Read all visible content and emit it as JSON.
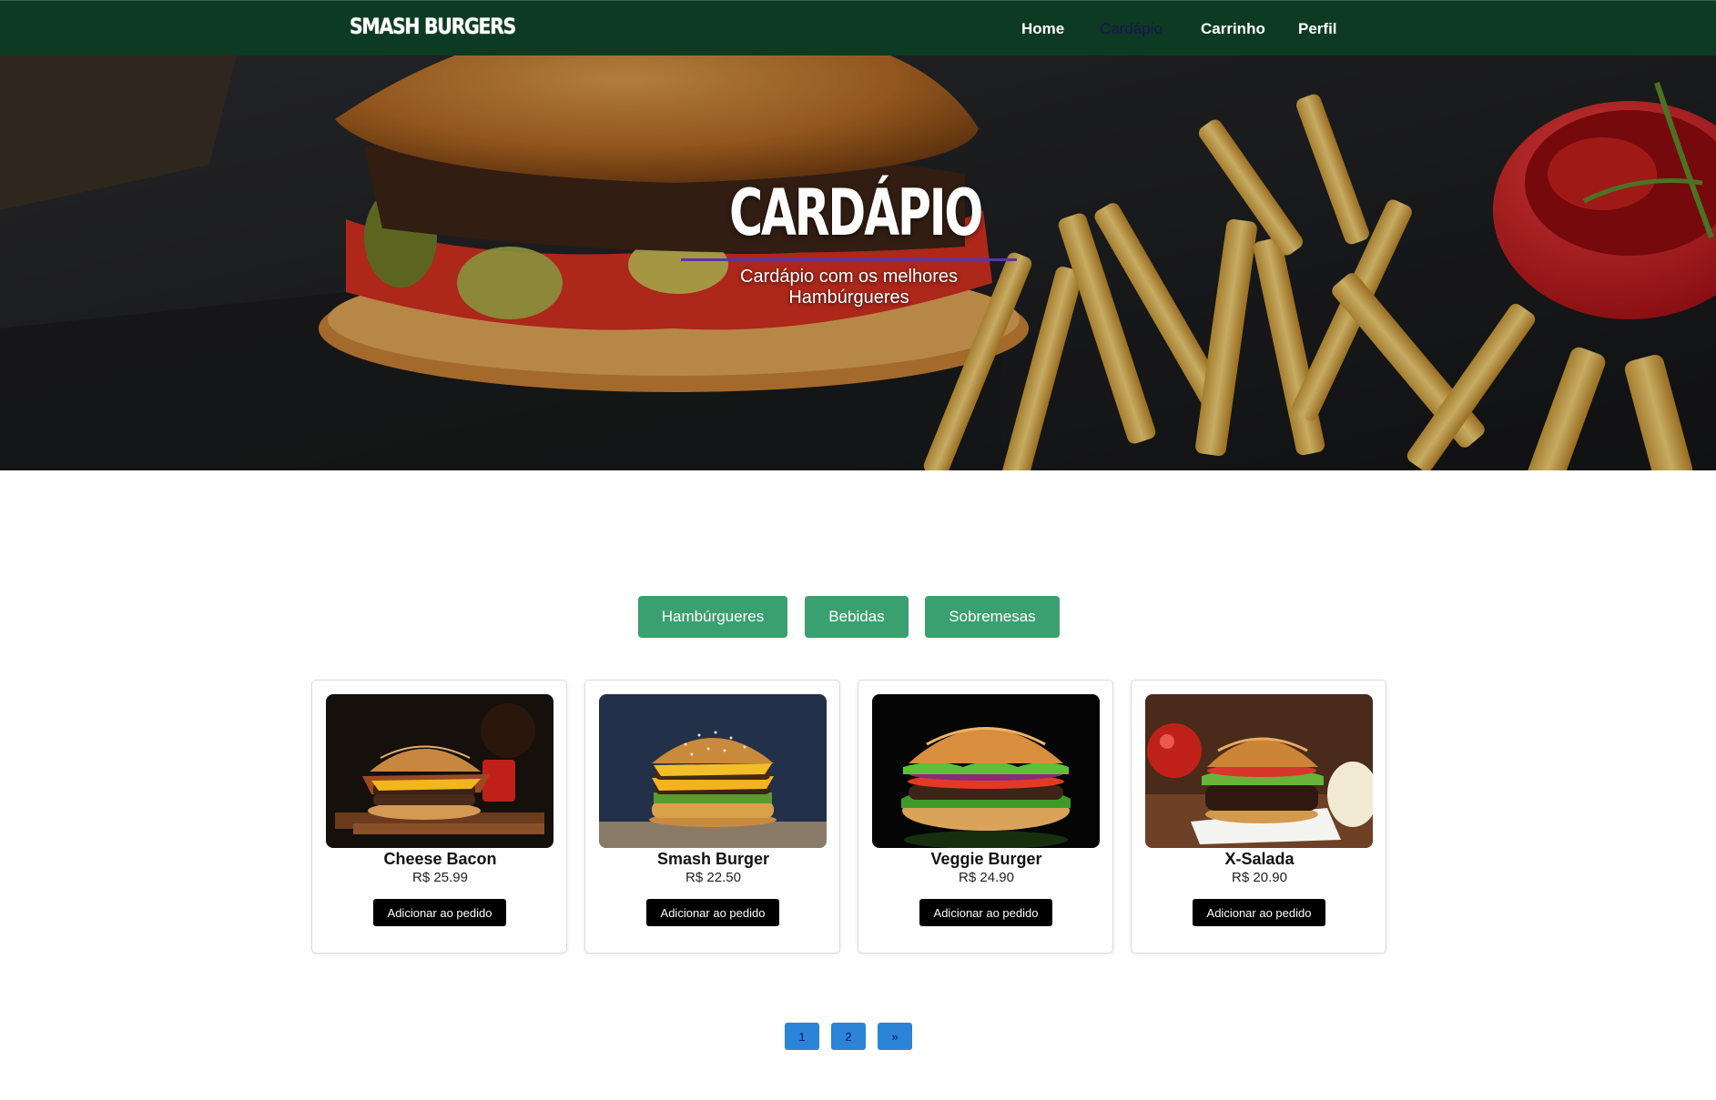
{
  "navbar": {
    "brand": "SMASH BURGERS",
    "links": [
      {
        "label": "Home"
      },
      {
        "label": "Cardápio"
      },
      {
        "label": "Carrinho"
      },
      {
        "label": "Perfil"
      }
    ]
  },
  "hero": {
    "title": "CARDÁPIO",
    "subtitle": "Cardápio com os melhores Hambúrgueres"
  },
  "categories": [
    "Hambúrgueres",
    "Bebidas",
    "Sobremesas"
  ],
  "products": [
    {
      "name": "Cheese Bacon",
      "price": "R$ 25.99",
      "button": "Adicionar ao pedido"
    },
    {
      "name": "Smash Burger",
      "price": "R$ 22.50",
      "button": "Adicionar ao pedido"
    },
    {
      "name": "Veggie Burger",
      "price": "R$ 24.90",
      "button": "Adicionar ao pedido"
    },
    {
      "name": "X-Salada",
      "price": "R$ 20.90",
      "button": "Adicionar ao pedido"
    }
  ],
  "pagination": [
    "1",
    "2",
    "»"
  ],
  "colors": {
    "navbar": "#0d3a22",
    "category_button": "#3aa070",
    "card_button": "#000000",
    "page_button": "#2b84d8",
    "hero_underline": "#5a35a8"
  }
}
